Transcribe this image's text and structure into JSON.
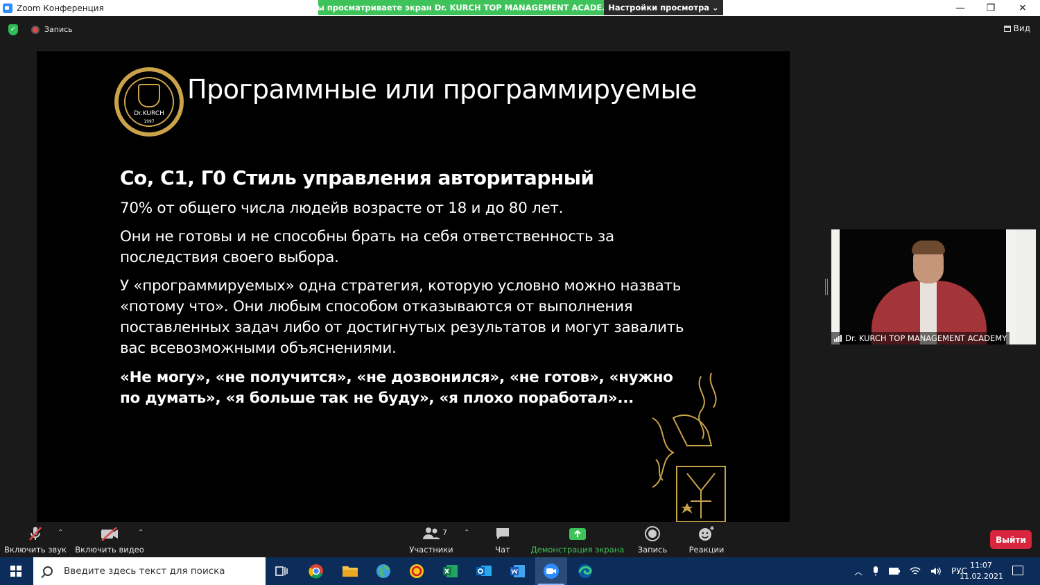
{
  "window": {
    "title": "Zoom Конференция",
    "controls": {
      "minimize": "—",
      "maximize": "❐",
      "close": "✕"
    }
  },
  "share_banner": {
    "message": "Вы просматриваете экран Dr. KURCH TOP MANAGEMENT ACADE...",
    "view_options": "Настройки просмотра ⌄"
  },
  "topbar": {
    "recording_label": "Запись",
    "view_label": "Вид"
  },
  "slide": {
    "logo": {
      "name": "Dr.KURCH",
      "year": "1997"
    },
    "title": "Программные или программируемые",
    "heading": "Co, C1, Г0  Стиль управления авторитарный",
    "paragraphs": [
      "70% от общего числа людейв возрасте от 18 и до 80 лет.",
      "Они не готовы и не способны брать на себя ответственность за последствия своего выбора.",
      " У «программируемых» одна стратегия, которую условно можно назвать «потому что». Они любым способом отказываются от выполнения поставленных задач либо от достигнутых результатов и могут завалить вас всевозможными объяснениями."
    ],
    "quote": "«Не могу», «не получится», «не дозвонился», «не готов», «нужно по думать», «я больше так не буду», «я плохо поработал»..."
  },
  "participant": {
    "name": "Dr. KURCH TOP MANAGEMENT ACADEMY"
  },
  "toolbar": {
    "unmute_label": "Включить звук",
    "start_video_label": "Включить видео",
    "participants_label": "Участники",
    "participants_count": "7",
    "chat_label": "Чат",
    "share_label": "Демонстрация экрана",
    "record_label": "Запись",
    "reactions_label": "Реакции",
    "leave_label": "Выйти",
    "caret": "⌃"
  },
  "taskbar": {
    "search_placeholder": "Введите здесь текст для поиска",
    "language": "РУС",
    "time": "11:07",
    "date": "11.02.2021"
  },
  "colors": {
    "accent_green": "#3ec35a",
    "leave_red": "#d7263d",
    "taskbar_blue": "#0c2d59",
    "gold": "#c9a24a"
  }
}
